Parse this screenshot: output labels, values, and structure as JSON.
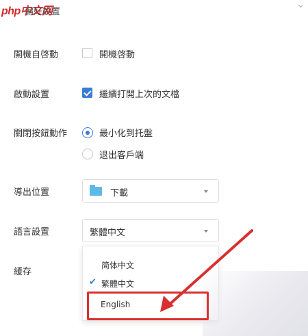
{
  "header": {
    "watermark": "php中文网",
    "title": "偏好設置"
  },
  "rows": {
    "autostart": {
      "label": "開機自啓動",
      "option": "開機啓動",
      "checked": false
    },
    "startup": {
      "label": "啟動設置",
      "option": "繼續打開上次的文檔",
      "checked": true
    },
    "close_action": {
      "label": "關閉按鈕動作",
      "options": [
        {
          "label": "最小化到托盤",
          "selected": true
        },
        {
          "label": "退出客戶端",
          "selected": false
        }
      ]
    },
    "export": {
      "label": "導出位置",
      "value": "下載"
    },
    "language": {
      "label": "語言設置",
      "value": "繁體中文",
      "options": [
        {
          "label": "简体中文",
          "checked": false
        },
        {
          "label": "繁體中文",
          "checked": true
        },
        {
          "label": "English",
          "checked": false
        }
      ]
    },
    "cache": {
      "label": "緩存"
    }
  },
  "colors": {
    "accent": "#3a7bd5",
    "annotation": "#d8302f",
    "folder": "#5eb8e8"
  },
  "icons": {
    "close": "close-icon",
    "folder": "folder-icon",
    "check": "check-icon",
    "caret": "chevron-down-icon"
  }
}
